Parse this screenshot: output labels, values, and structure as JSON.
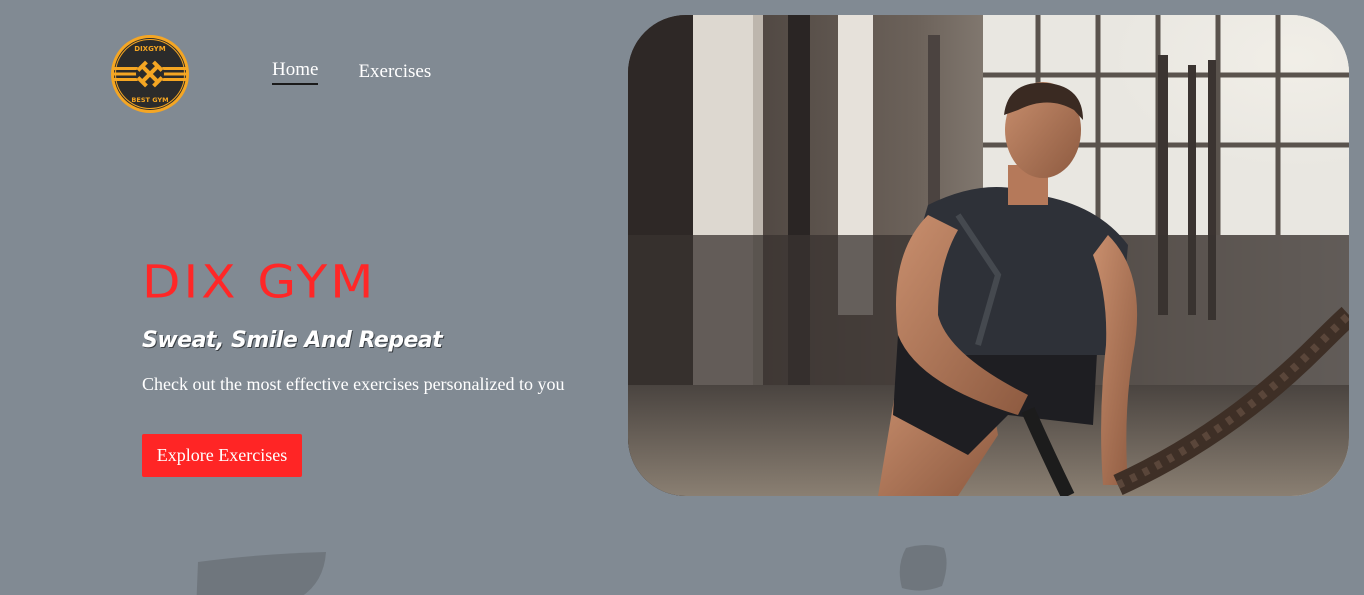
{
  "brand": {
    "logo_icon": "dumbbell-cross-badge-icon",
    "logo_top_text": "DIXGYM",
    "logo_bottom_text": "BEST GYM",
    "logo_color": "#f5a623"
  },
  "nav": {
    "items": [
      {
        "label": "Home",
        "active": true
      },
      {
        "label": "Exercises",
        "active": false
      }
    ]
  },
  "hero": {
    "title": "DIX GYM",
    "subtitle": "Sweat, Smile And Repeat",
    "description": "Check out the most effective exercises personalized to you",
    "cta_label": "Explore Exercises",
    "image_alt": "man training with battle ropes in gym"
  },
  "colors": {
    "background": "#818a93",
    "accent": "#ff2525",
    "text": "#ffffff"
  }
}
